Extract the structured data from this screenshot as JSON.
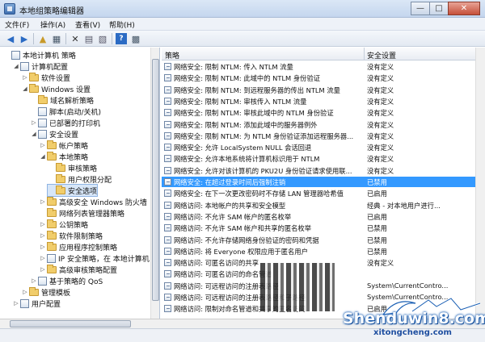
{
  "window": {
    "title": "本地组策略编辑器",
    "minimize": "—",
    "maximize": "□",
    "close": "✕"
  },
  "menu": [
    "文件(F)",
    "操作(A)",
    "查看(V)",
    "帮助(H)"
  ],
  "toolbar": [
    "back-icon",
    "forward-icon",
    "up-folder-icon",
    "show-tree-icon",
    "delete-icon",
    "properties-icon",
    "export-icon",
    "help-icon",
    "view-icon"
  ],
  "tree": [
    {
      "label": "本地计算机 策略",
      "indent": 0,
      "icon": "policy",
      "tw": ""
    },
    {
      "label": "计算机配置",
      "indent": 1,
      "icon": "policy",
      "tw": "◢"
    },
    {
      "label": "软件设置",
      "indent": 2,
      "icon": "folder",
      "tw": "▷"
    },
    {
      "label": "Windows 设置",
      "indent": 2,
      "icon": "folder",
      "tw": "◢"
    },
    {
      "label": "域名解析策略",
      "indent": 3,
      "icon": "folder",
      "tw": ""
    },
    {
      "label": "脚本(启动/关机)",
      "indent": 3,
      "icon": "policy",
      "tw": ""
    },
    {
      "label": "已部署的打印机",
      "indent": 3,
      "icon": "policy",
      "tw": "▷"
    },
    {
      "label": "安全设置",
      "indent": 3,
      "icon": "policy",
      "tw": "◢"
    },
    {
      "label": "帐户策略",
      "indent": 4,
      "icon": "folder",
      "tw": "▷"
    },
    {
      "label": "本地策略",
      "indent": 4,
      "icon": "folder",
      "tw": "◢"
    },
    {
      "label": "审核策略",
      "indent": 5,
      "icon": "folder",
      "tw": ""
    },
    {
      "label": "用户权限分配",
      "indent": 5,
      "icon": "folder",
      "tw": ""
    },
    {
      "label": "安全选项",
      "indent": 5,
      "icon": "folder",
      "tw": "",
      "selected": true
    },
    {
      "label": "高级安全 Windows 防火墙",
      "indent": 4,
      "icon": "folder",
      "tw": "▷"
    },
    {
      "label": "网络列表管理器策略",
      "indent": 4,
      "icon": "folder",
      "tw": ""
    },
    {
      "label": "公钥策略",
      "indent": 4,
      "icon": "folder",
      "tw": "▷"
    },
    {
      "label": "软件限制策略",
      "indent": 4,
      "icon": "folder",
      "tw": "▷"
    },
    {
      "label": "应用程序控制策略",
      "indent": 4,
      "icon": "folder",
      "tw": "▷"
    },
    {
      "label": "IP 安全策略，在 本地计算机",
      "indent": 4,
      "icon": "policy",
      "tw": "▷"
    },
    {
      "label": "高级审核策略配置",
      "indent": 4,
      "icon": "folder",
      "tw": "▷"
    },
    {
      "label": "基于策略的 QoS",
      "indent": 3,
      "icon": "policy",
      "tw": "▷"
    },
    {
      "label": "管理模板",
      "indent": 2,
      "icon": "folder",
      "tw": "▷"
    },
    {
      "label": "用户配置",
      "indent": 1,
      "icon": "policy",
      "tw": "▷"
    }
  ],
  "columns": {
    "policy": "策略",
    "setting": "安全设置"
  },
  "rows": [
    {
      "name": "网络安全: 限制 NTLM: 传入 NTLM 流量",
      "value": "没有定义"
    },
    {
      "name": "网络安全: 限制 NTLM: 此域中的 NTLM 身份验证",
      "value": "没有定义"
    },
    {
      "name": "网络安全: 限制 NTLM: 到远程服务器的传出 NTLM 流量",
      "value": "没有定义"
    },
    {
      "name": "网络安全: 限制 NTLM: 审核传入 NTLM 流量",
      "value": "没有定义"
    },
    {
      "name": "网络安全: 限制 NTLM: 审核此域中的 NTLM 身份验证",
      "value": "没有定义"
    },
    {
      "name": "网络安全: 限制 NTLM: 添加此域中的服务器例外",
      "value": "没有定义"
    },
    {
      "name": "网络安全: 限制 NTLM: 为 NTLM 身份验证添加远程服务器...",
      "value": "没有定义"
    },
    {
      "name": "网络安全: 允许 LocalSystem NULL 会话回退",
      "value": "没有定义"
    },
    {
      "name": "网络安全: 允许本地系统将计算机标识用于 NTLM",
      "value": "没有定义"
    },
    {
      "name": "网络安全: 允许对该计算机的 PKU2U 身份验证请求使用联...",
      "value": "没有定义"
    },
    {
      "name": "网络安全: 在超过登录时间后强制注销",
      "value": "已禁用",
      "highlight": true
    },
    {
      "name": "网络安全: 在下一次更改密码时不存储 LAN 管理器哈希值",
      "value": "已启用"
    },
    {
      "name": "网络访问: 本地帐户的共享和安全模型",
      "value": "经典 - 对本地用户进行..."
    },
    {
      "name": "网络访问: 不允许 SAM 帐户的匿名枚举",
      "value": "已启用"
    },
    {
      "name": "网络访问: 不允许 SAM 帐户和共享的匿名枚举",
      "value": "已禁用"
    },
    {
      "name": "网络访问: 不允许存储网络身份验证的密码和凭据",
      "value": "已禁用"
    },
    {
      "name": "网络访问: 将 Everyone 权限应用于匿名用户",
      "value": "已禁用"
    },
    {
      "name": "网络访问: 可匿名访问的共享",
      "value": "没有定义"
    },
    {
      "name": "网络访问: 可匿名访问的命名管道",
      "value": ""
    },
    {
      "name": "网络访问: 可远程访问的注册表路径",
      "value": "System\\CurrentContro..."
    },
    {
      "name": "网络访问: 可远程访问的注册表路径和子路径",
      "value": "System\\CurrentContro..."
    },
    {
      "name": "网络访问: 限制对命名管道和共享的匿名访问",
      "value": "已启用"
    }
  ],
  "watermark": {
    "brand": "Shenduwin8.com",
    "site": "xitongcheng.com"
  }
}
